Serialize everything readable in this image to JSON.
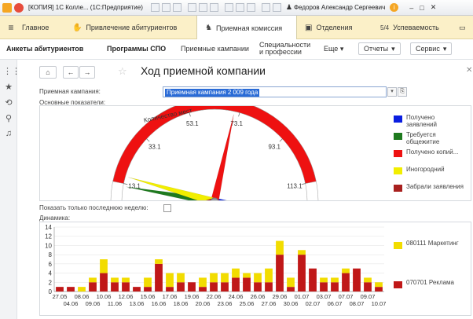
{
  "window": {
    "title": "[КОПИЯ] 1С Колле... (1С:Предприятие)",
    "user": "Федоров Александр Сергеевич"
  },
  "tabs": [
    {
      "label": "Главное"
    },
    {
      "label": "Привлечение абитуриентов"
    },
    {
      "label": "Приемная комиссия"
    },
    {
      "label": "Отделения"
    },
    {
      "label": "Успеваемость"
    }
  ],
  "tab_badge": "5/4",
  "menu": {
    "item1": "Анкеты абитуриентов",
    "item2": "Программы СПО",
    "item3": "Приемные кампании",
    "item4": "Специальности и профессии",
    "more": "Еще",
    "reports": "Отчеты",
    "service": "Сервис"
  },
  "page": {
    "title": "Ход приемной компании",
    "campaign_label": "Приемная кампания:",
    "campaign_value": "Приемная кампания 2 009 года",
    "main_indicators": "Основные показатели:",
    "last_week_label": "Показать только последнюю неделю:",
    "dynamics_label": "Динамика:"
  },
  "gauge": {
    "arc_label": "Количество мест",
    "ticks": [
      "-6.9",
      "13.1",
      "33.1",
      "53.1",
      "73.1",
      "93.1",
      "113.1",
      "133.1"
    ],
    "min": -6.9,
    "max": 133.1,
    "needles": [
      {
        "name": "Получено заявлений",
        "color": "#0a1ee0",
        "value": 126
      },
      {
        "name": "Требуется общежитие",
        "color": "#1e7a1e",
        "value": 12
      },
      {
        "name": "Получено копий...",
        "color": "#ee1111",
        "value": 71
      },
      {
        "name": "Иногородний",
        "color": "#f2ee00",
        "value": 16
      },
      {
        "name": "Забрали заявления",
        "color": "#a8201e",
        "value": -3
      }
    ]
  },
  "legend_gauge": [
    {
      "label": "Получено заявлений",
      "color": "#0a1ee0"
    },
    {
      "label": "Требуется общежитие",
      "color": "#1e7a1e"
    },
    {
      "label": "Получено копий...",
      "color": "#ee1111"
    },
    {
      "label": "Иногородний",
      "color": "#f2ee00"
    },
    {
      "label": "Забрали заявления",
      "color": "#a8201e"
    }
  ],
  "chart_data": {
    "type": "bar",
    "stacked": true,
    "ylim": [
      0,
      14
    ],
    "yticks": [
      0,
      2,
      4,
      6,
      8,
      10,
      12,
      14
    ],
    "categories": [
      "27.05",
      "04.06",
      "08.06",
      "09.06",
      "10.06",
      "11.06",
      "12.06",
      "13.06",
      "15.06",
      "16.06",
      "17.06",
      "18.06",
      "19.06",
      "20.06",
      "22.06",
      "23.06",
      "24.06",
      "25.06",
      "26.06",
      "27.06",
      "29.06",
      "30.06",
      "01.07",
      "02.07",
      "03.07",
      "06.07",
      "07.07",
      "08.07",
      "09.07",
      "10.07"
    ],
    "series": [
      {
        "name": "070701 Реклама",
        "color": "#c01818",
        "values": [
          1,
          1,
          0,
          2,
          4,
          2,
          2,
          1,
          1,
          6,
          1,
          2,
          2,
          1,
          2,
          2,
          3,
          3,
          2,
          2,
          8,
          1,
          8,
          5,
          2,
          2,
          4,
          5,
          2,
          1
        ]
      },
      {
        "name": "080111 Маркетинг",
        "color": "#f2dc00",
        "values": [
          0,
          0,
          1,
          1,
          3,
          1,
          1,
          0,
          2,
          1,
          3,
          2,
          0,
          2,
          2,
          2,
          2,
          1,
          2,
          3,
          3,
          2,
          1,
          0,
          1,
          1,
          1,
          0,
          1,
          1
        ]
      }
    ]
  },
  "legend_chart": [
    {
      "label": "080111 Маркетинг",
      "color": "#f2dc00"
    },
    {
      "label": "070701 Реклама",
      "color": "#c01818"
    }
  ]
}
